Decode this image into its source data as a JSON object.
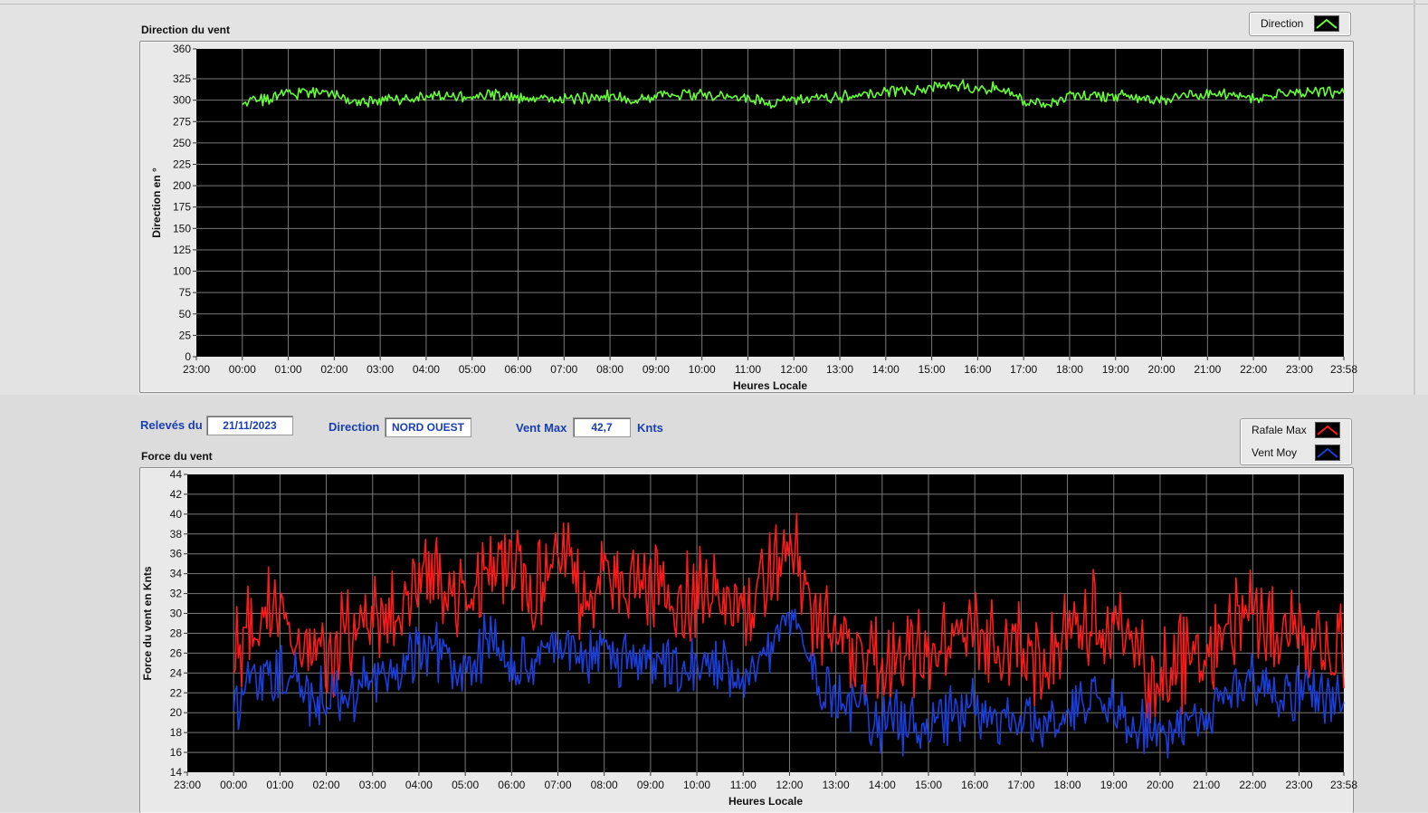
{
  "chart_data": [
    {
      "type": "line",
      "title": "Direction du vent",
      "xlabel": "Heures Locale",
      "ylabel": "Direction en °",
      "ylim": [
        0,
        360
      ],
      "yticks": [
        "0",
        "25",
        "50",
        "75",
        "100",
        "125",
        "150",
        "175",
        "200",
        "225",
        "250",
        "275",
        "300",
        "325",
        "360"
      ],
      "xticks": [
        "23:00",
        "00:00",
        "01:00",
        "02:00",
        "03:00",
        "04:00",
        "05:00",
        "06:00",
        "07:00",
        "08:00",
        "09:00",
        "10:00",
        "11:00",
        "12:00",
        "13:00",
        "14:00",
        "15:00",
        "16:00",
        "17:00",
        "18:00",
        "19:00",
        "20:00",
        "21:00",
        "22:00",
        "23:00",
        "23:58"
      ],
      "grid": true,
      "legend": "top-right",
      "series": [
        {
          "name": "Direction",
          "color": "#66ff33",
          "x": [
            "00:00",
            "00:30",
            "01:00",
            "01:30",
            "02:00",
            "02:30",
            "03:00",
            "03:30",
            "04:00",
            "04:30",
            "05:00",
            "05:30",
            "06:00",
            "06:30",
            "07:00",
            "07:30",
            "08:00",
            "08:30",
            "09:00",
            "09:30",
            "10:00",
            "10:30",
            "11:00",
            "11:30",
            "12:00",
            "12:30",
            "13:00",
            "13:30",
            "14:00",
            "14:30",
            "15:00",
            "15:30",
            "16:00",
            "16:30",
            "17:00",
            "17:30",
            "18:00",
            "18:30",
            "19:00",
            "19:30",
            "20:00",
            "20:30",
            "21:00",
            "21:30",
            "22:00",
            "22:30",
            "23:00",
            "23:30",
            "23:58"
          ],
          "values": [
            300,
            300,
            308,
            309,
            306,
            298,
            300,
            302,
            303,
            304,
            304,
            305,
            303,
            301,
            302,
            303,
            304,
            300,
            306,
            307,
            307,
            304,
            302,
            297,
            300,
            302,
            303,
            306,
            311,
            310,
            314,
            317,
            316,
            313,
            300,
            295,
            304,
            305,
            305,
            302,
            300,
            305,
            307,
            305,
            304,
            304,
            307,
            310,
            307
          ]
        }
      ]
    },
    {
      "type": "line",
      "title": "Force du vent",
      "xlabel": "Heures Locale",
      "ylabel": "Force du vent en Knts",
      "ylim": [
        14,
        44
      ],
      "yticks": [
        "14",
        "16",
        "18",
        "20",
        "22",
        "24",
        "26",
        "28",
        "30",
        "32",
        "34",
        "36",
        "38",
        "40",
        "42",
        "44"
      ],
      "xticks": [
        "23:00",
        "00:00",
        "01:00",
        "02:00",
        "03:00",
        "04:00",
        "05:00",
        "06:00",
        "07:00",
        "08:00",
        "09:00",
        "10:00",
        "11:00",
        "12:00",
        "13:00",
        "14:00",
        "15:00",
        "16:00",
        "17:00",
        "18:00",
        "19:00",
        "20:00",
        "21:00",
        "22:00",
        "23:00",
        "23:58"
      ],
      "grid": true,
      "legend": "top-right",
      "series": [
        {
          "name": "Rafale Max",
          "color": "#ff1a1a",
          "x": [
            "00:00",
            "00:30",
            "01:00",
            "01:30",
            "02:00",
            "02:30",
            "03:00",
            "03:30",
            "04:00",
            "04:30",
            "05:00",
            "05:30",
            "06:00",
            "06:30",
            "07:00",
            "07:30",
            "08:00",
            "08:30",
            "09:00",
            "09:30",
            "10:00",
            "10:30",
            "11:00",
            "11:30",
            "12:00",
            "12:30",
            "13:00",
            "13:30",
            "14:00",
            "14:30",
            "15:00",
            "15:30",
            "16:00",
            "16:30",
            "17:00",
            "17:30",
            "18:00",
            "18:30",
            "19:00",
            "19:30",
            "20:00",
            "20:30",
            "21:00",
            "21:30",
            "22:00",
            "22:30",
            "23:00",
            "23:30",
            "23:58"
          ],
          "values": [
            27,
            29,
            30,
            27,
            26,
            28,
            29,
            31,
            34,
            33,
            32,
            34,
            35,
            32,
            36,
            32,
            34,
            32,
            33,
            31,
            31,
            33,
            30,
            33,
            37,
            30,
            28,
            26,
            25,
            26,
            26,
            27,
            28,
            26,
            27,
            24,
            29,
            30,
            28,
            25,
            23,
            25,
            26,
            29,
            31,
            27,
            26,
            28,
            27
          ]
        },
        {
          "name": "Vent Moy",
          "color": "#1a3fdb",
          "x": [
            "00:00",
            "00:30",
            "01:00",
            "01:30",
            "02:00",
            "02:30",
            "03:00",
            "03:30",
            "04:00",
            "04:30",
            "05:00",
            "05:30",
            "06:00",
            "06:30",
            "07:00",
            "07:30",
            "08:00",
            "08:30",
            "09:00",
            "09:30",
            "10:00",
            "10:30",
            "11:00",
            "11:30",
            "12:00",
            "12:30",
            "13:00",
            "13:30",
            "14:00",
            "14:30",
            "15:00",
            "15:30",
            "16:00",
            "16:30",
            "17:00",
            "17:30",
            "18:00",
            "18:30",
            "19:00",
            "19:30",
            "20:00",
            "20:30",
            "21:00",
            "21:30",
            "22:00",
            "22:30",
            "23:00",
            "23:30",
            "23:58"
          ],
          "values": [
            21,
            23,
            24,
            22,
            21,
            22,
            23,
            24,
            26,
            26,
            25,
            27,
            26,
            25,
            27,
            25,
            26,
            25,
            25,
            24,
            24,
            25,
            24,
            26,
            30,
            24,
            22,
            21,
            19,
            19,
            19,
            20,
            21,
            19,
            19,
            19,
            20,
            22,
            21,
            19,
            18,
            18,
            19,
            22,
            24,
            22,
            21,
            22,
            21
          ]
        }
      ]
    }
  ],
  "info": {
    "releves_label": "Relevés du",
    "date": "21/11/2023",
    "direction_label": "Direction",
    "direction_value": "NORD OUEST",
    "ventmax_label": "Vent Max",
    "ventmax_value": "42,7",
    "unit": "Knts"
  }
}
